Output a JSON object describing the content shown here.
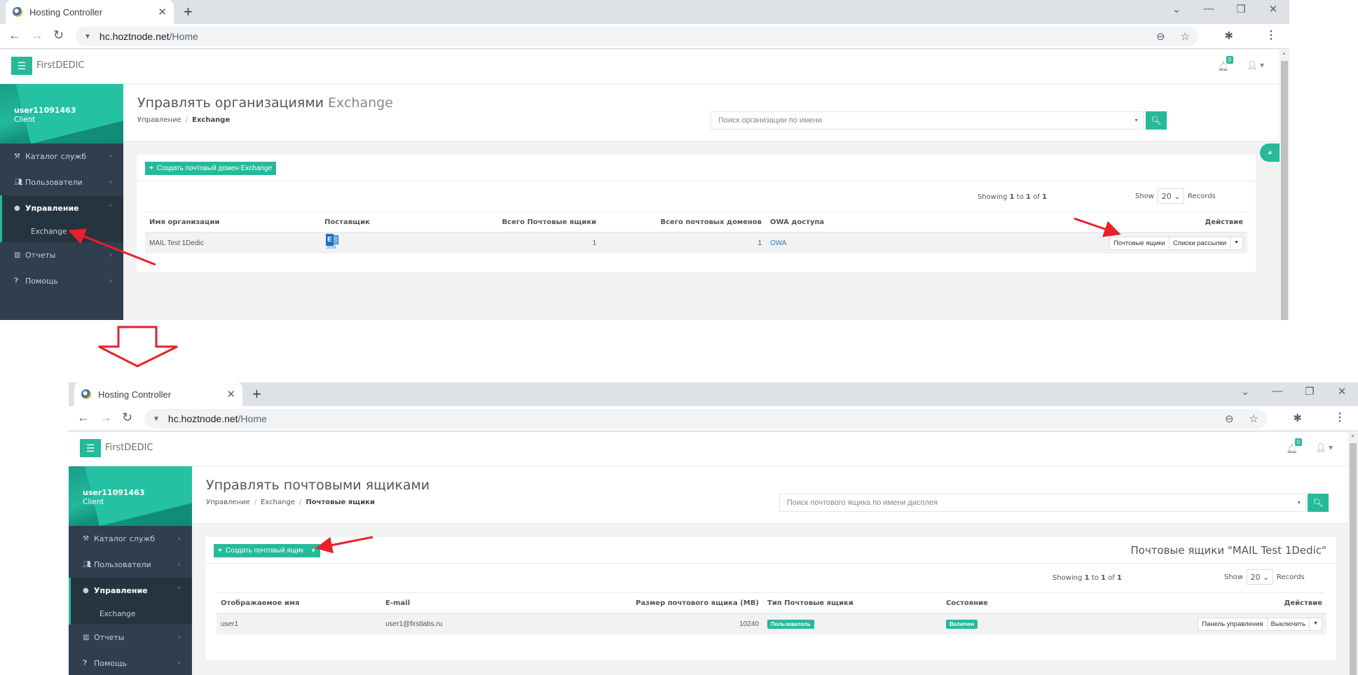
{
  "browser": {
    "tab_title": "Hosting Controller",
    "url_host": "hc.hoztnode.net",
    "url_path": "/Home",
    "new_tab": "+",
    "close_tab": "✕"
  },
  "app": {
    "brand": "FirstDEDIC",
    "notifications_count": "0",
    "user": {
      "name": "user11091463",
      "role": "Client"
    },
    "sidebar": [
      {
        "label": "Каталог служб",
        "icon": "gavel-icon"
      },
      {
        "label": "Пользователи",
        "icon": "users-icon"
      },
      {
        "label": "Управление",
        "icon": "globe-icon",
        "active": true
      },
      {
        "label": "Отчеты",
        "icon": "bar-chart-icon"
      },
      {
        "label": "Помощь",
        "icon": "question-icon"
      }
    ],
    "sidebar_sub": {
      "label": "Exchange"
    }
  },
  "screen1": {
    "title_main": "Управлять организациями",
    "title_sub": "Exchange",
    "breadcrumb": [
      "Управление",
      "Exchange"
    ],
    "search_placeholder": "Поиск организации по имени",
    "create_button": "Создать почтовый домен Exchange",
    "showing": {
      "prefix": "Showing",
      "from": "1",
      "to_word": "to",
      "to": "1",
      "of_word": "of",
      "total": "1"
    },
    "show_label": "Show",
    "page_size": "20",
    "records_label": "Records",
    "columns": [
      "Имя организации",
      "Поставщик",
      "Всего Почтовые ящики",
      "Всего почтовых доменов",
      "OWA доступа",
      "Действие"
    ],
    "rows": [
      {
        "name": "MAIL Test 1Dedic",
        "provider": "Exchange 2019",
        "provider_year": "2019",
        "mailboxes": "1",
        "domains": "1",
        "owa": "OWA",
        "actions": [
          "Почтовые ящики",
          "Списки рассылки"
        ]
      }
    ]
  },
  "screen2": {
    "title_main": "Управлять почтовыми ящиками",
    "breadcrumb": [
      "Управление",
      "Exchange",
      "Почтовые ящики"
    ],
    "search_placeholder": "Поиск почтового ящика по имени дисплея",
    "create_button": "Создать почтовый ящик",
    "box_title": "Почтовые ящики \"MAIL Test 1Dedic\"",
    "showing": {
      "prefix": "Showing",
      "from": "1",
      "to_word": "to",
      "to": "1",
      "of_word": "of",
      "total": "1"
    },
    "show_label": "Show",
    "page_size": "20",
    "records_label": "Records",
    "columns": [
      "Отображаемое имя",
      "E-mail",
      "Размер почтового ящика (MB)",
      "Тип Почтовые ящики",
      "Состояние",
      "Действие"
    ],
    "rows": [
      {
        "display_name": "user1",
        "email": "user1@firstlabs.ru",
        "size_mb": "10240",
        "type": "Пользователь",
        "status": "Включен",
        "actions": [
          "Панель управления",
          "Выключить"
        ]
      }
    ]
  },
  "colors": {
    "accent": "#26b99a",
    "sidebar": "#2f3f4e",
    "annotation": "#e8202a",
    "link": "#337ab7"
  }
}
